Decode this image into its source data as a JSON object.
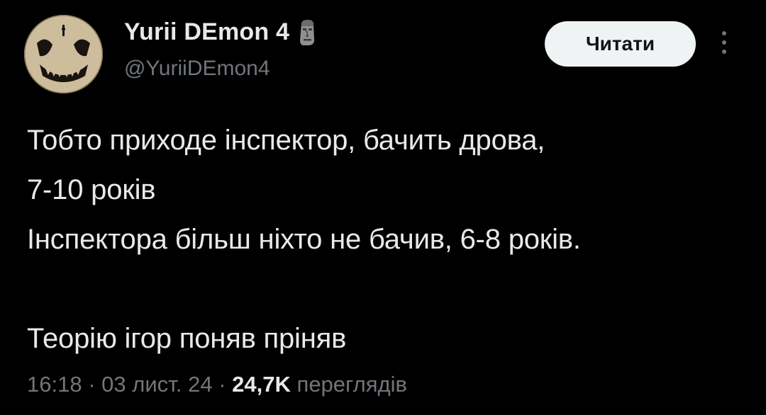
{
  "author": {
    "display_name": "Yurii DEmon 4",
    "handle": "@YuriiDEmon4",
    "avatar_icon": "demon-face-avatar",
    "badge_icon": "moai-emoji-icon"
  },
  "follow_button": {
    "label": "Читати"
  },
  "more_menu": {
    "icon": "vertical-ellipsis-icon"
  },
  "tweet": {
    "lines": [
      "Тобто приходе інспектор, бачить дрова,",
      "7-10 років",
      "Інспектора більш ніхто не бачив, 6-8 років.",
      "",
      "Теорію ігор поняв пріняв"
    ]
  },
  "meta": {
    "time": "16:18",
    "separator": " · ",
    "date": "03 лист. 24",
    "views_count": "24,7K",
    "views_label": "переглядів"
  },
  "colors": {
    "background": "#000000",
    "text_primary": "#e7e9ea",
    "text_secondary": "#71767b",
    "button_bg": "#eff3f4",
    "button_text": "#0f1419"
  }
}
